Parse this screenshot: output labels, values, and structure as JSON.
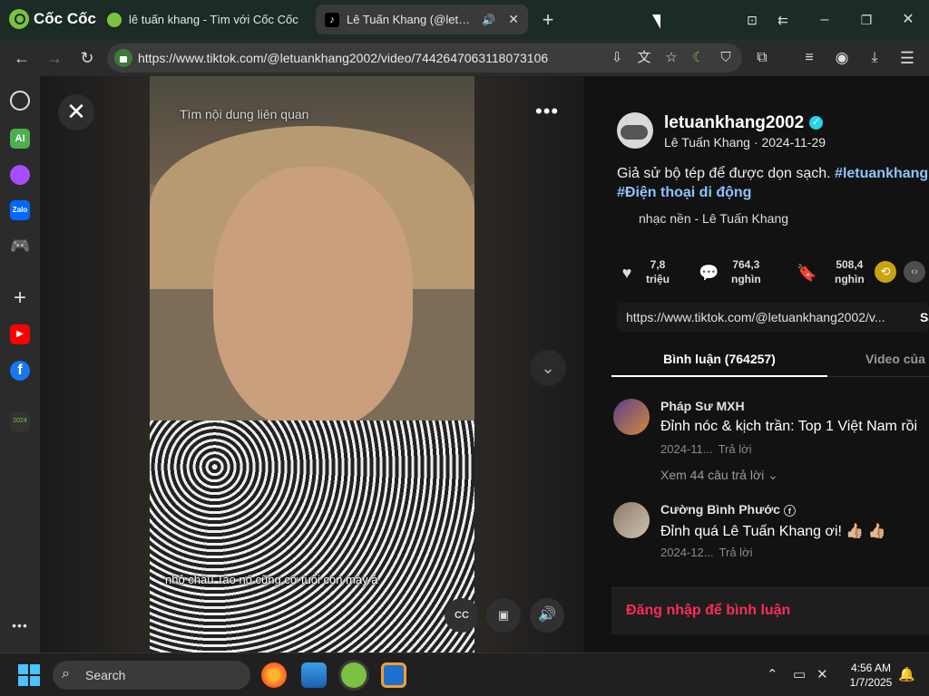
{
  "browser": {
    "brand": "Cốc Cốc",
    "tabs": [
      {
        "title": "lê tuấn khang - Tìm với Cốc Cốc"
      },
      {
        "title": "Lê Tuấn Khang (@letuankhang2002) | TikTok"
      }
    ],
    "url": "https://www.tiktok.com/@letuankhang2002/video/7442647063118073106"
  },
  "video": {
    "close_symbol": "✕",
    "more_symbol": "•••",
    "search_related": "Tìm nội dung liên quan",
    "caption": "nhỏ cháu Tao nó cũng cỡ tuổi con mày á",
    "cc_label": "CC"
  },
  "post": {
    "username": "letuankhang2002",
    "display_name": "Lê Tuấn Khang",
    "date": "2024-11-29",
    "separator": " · ",
    "description": "Giả sử bộ tép để được dọn sạch. ",
    "hashtag1": "#letuankhang",
    "hashtag2": "#Điện thoại di động",
    "music": "nhạc nền - Lê Tuấn Khang",
    "likes_value": "7,8",
    "likes_unit": "triệu",
    "comments_value": "764,3",
    "comments_unit": "nghìn",
    "saves_value": "508,4",
    "saves_unit": "nghìn",
    "link": "https://www.tiktok.com/@letuankhang2002/v...",
    "copy_label": "Sa"
  },
  "tabs": {
    "comments": "Bình luận (764257)",
    "videos": "Video của n"
  },
  "comments": [
    {
      "name": "Pháp Sư MXH",
      "text": "Đỉnh nóc & kịch trần: Top 1 Việt Nam rồi",
      "date": "2024-11...",
      "reply": "Trả lời"
    },
    {
      "name": "Cường Bình Phước",
      "text": "Đỉnh quá Lê Tuấn Khang ơi! 👍🏼 👍🏼",
      "date": "2024-12...",
      "reply": "Trả lời"
    }
  ],
  "view_replies": "Xem 44 câu trả lời ⌄",
  "login_prompt": "Đăng nhập để bình luận",
  "taskbar": {
    "search_label": "Search",
    "time": "4:56 AM",
    "date": "1/7/2025"
  },
  "colors": {
    "accent_red": "#fe2c55",
    "hashtag_blue": "#8fc3ff",
    "verified": "#20d5ec"
  }
}
